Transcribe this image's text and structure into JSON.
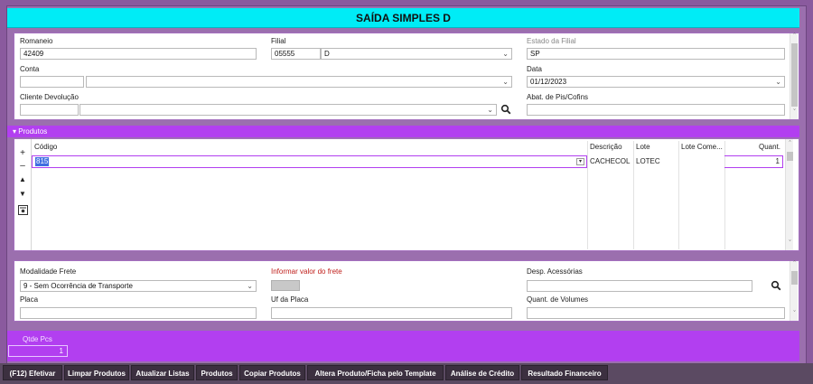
{
  "title": "SAÍDA SIMPLES D",
  "form": {
    "romaneio_label": "Romaneio",
    "romaneio_value": "42409",
    "filial_label": "Filial",
    "filial_code": "05555",
    "filial_name": "D",
    "estado_label": "Estado da Filial",
    "estado_value": "SP",
    "conta_label": "Conta",
    "data_label": "Data",
    "data_value": "01/12/2023",
    "cliente_label": "Cliente Devolução",
    "abat_label": "Abat. de Pis/Cofins"
  },
  "produtos": {
    "section_label": "Produtos",
    "columns": [
      "Código",
      "Descrição",
      "Lote",
      "Lote Come...",
      "Quant."
    ],
    "row": {
      "codigo": "815",
      "descricao": "CACHECOL",
      "lote": "LOTEC",
      "lote_come": "",
      "quant": "1"
    }
  },
  "frete": {
    "modalidade_label": "Modalidade Frete",
    "modalidade_value": "9 - Sem Ocorrência de Transporte",
    "informar_label": "Informar valor do frete",
    "desp_label": "Desp. Acessórias",
    "placa_label": "Placa",
    "uf_label": "Uf da Placa",
    "quant_volumes_label": "Quant. de Volumes"
  },
  "qtde": {
    "label": "Qtde Pcs",
    "value": "1"
  },
  "buttons": [
    "(F12) Efetivar",
    "Limpar Produtos",
    "Atualizar Listas",
    "Produtos",
    "Copiar Produtos",
    "Altera Produto/Ficha pelo Template",
    "Análise de Crédito",
    "Resultado Financeiro"
  ],
  "colors": {
    "title_bg": "#00ecf6",
    "accent": "#b23ff0",
    "highlight": "#3f6fe0"
  }
}
